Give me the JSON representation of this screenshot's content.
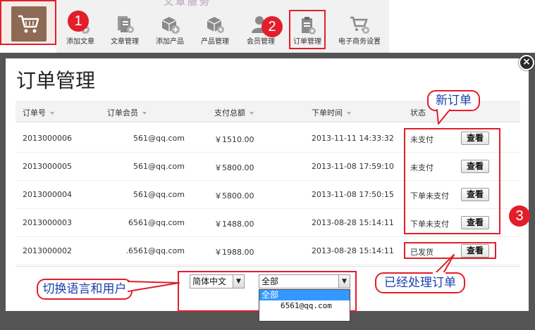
{
  "faded_text": "文章服务",
  "toolbar": {
    "items": [
      {
        "label": "添加文章",
        "icon": "add-article-icon"
      },
      {
        "label": "文章管理",
        "icon": "article-manage-icon"
      },
      {
        "label": "添加产品",
        "icon": "add-product-icon"
      },
      {
        "label": "产品管理",
        "icon": "product-manage-icon"
      },
      {
        "label": "会员管理",
        "icon": "member-manage-icon"
      },
      {
        "label": "订单管理",
        "icon": "order-manage-icon"
      },
      {
        "label": "电子商务设置",
        "icon": "ecommerce-settings-icon"
      }
    ]
  },
  "annotations": {
    "n1": "1",
    "n2": "2",
    "n3": "3"
  },
  "modal": {
    "title": "订单管理",
    "close": "×",
    "columns": [
      "订单号",
      "订单会员",
      "支付总额",
      "下单时间",
      "状态"
    ],
    "rows": [
      {
        "order_no": "2013000006",
        "member": "561@qq.com",
        "amount": "￥1510.00",
        "time": "2013-11-11 14:33:32",
        "status": "未支付",
        "action": "查看"
      },
      {
        "order_no": "2013000005",
        "member": "561@qq.com",
        "amount": "￥5800.00",
        "time": "2013-11-08 17:59:10",
        "status": "未支付",
        "action": "查看"
      },
      {
        "order_no": "2013000004",
        "member": "561@qq.com",
        "amount": "￥5800.00",
        "time": "2013-11-08 17:50:15",
        "status": "下单未支付",
        "action": "查看"
      },
      {
        "order_no": "2013000003",
        "member": "6561@qq.com",
        "amount": "￥1488.00",
        "time": "2013-08-28 15:14:11",
        "status": "下单未支付",
        "action": "查看"
      },
      {
        "order_no": "2013000002",
        "member": ".6561@qq.com",
        "amount": "￥1988.00",
        "time": "2013-08-28 15:14:11",
        "status": "已发货",
        "action": "查看"
      }
    ],
    "language_select": "简体中文",
    "user_select": "全部",
    "user_options": [
      "全部",
      "6561@qq.com"
    ]
  },
  "callouts": {
    "new_order": "新订单",
    "processed": "已经处理订单",
    "switch": "切换语言和用户"
  },
  "colors": {
    "accent_red": "#e11e2a",
    "callout_text": "#1a3fae",
    "cart_brown": "#8c6a54",
    "overlay": "#545454",
    "highlight": "#3399ff"
  }
}
